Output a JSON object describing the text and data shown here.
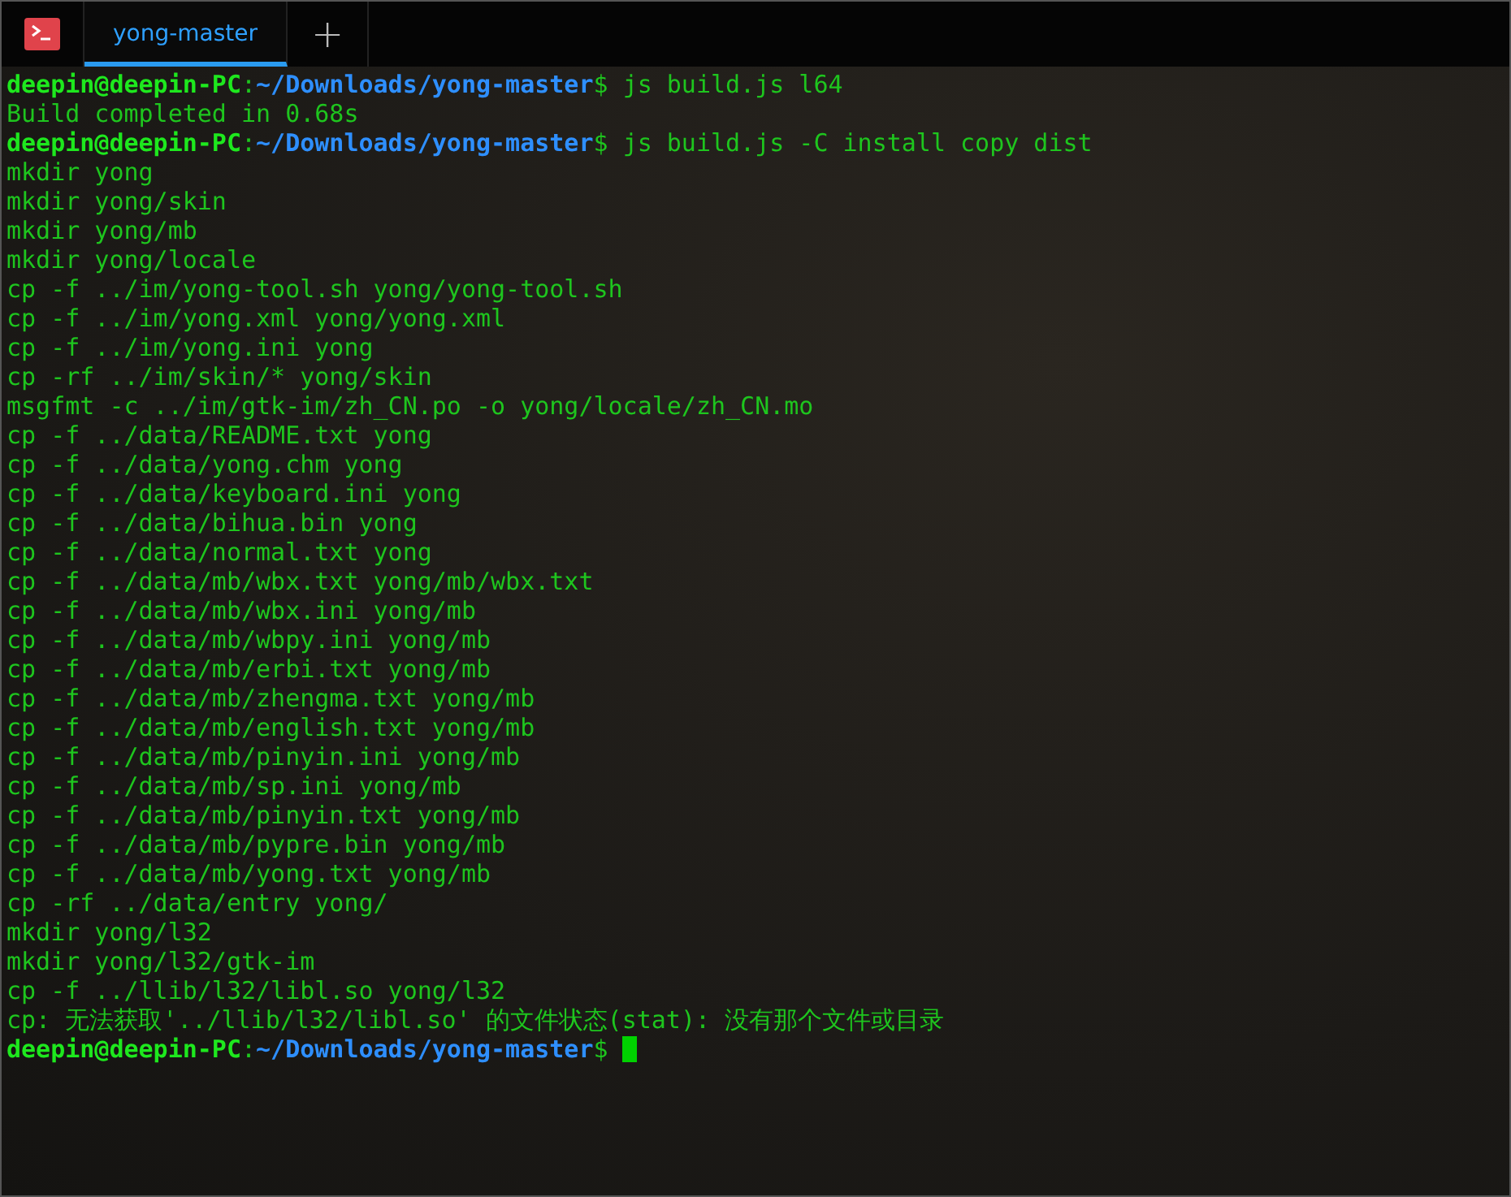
{
  "tabs": [
    {
      "label": "yong-master",
      "selected": true
    }
  ],
  "new_tab": "+",
  "lines": [
    {
      "kind": "prompt",
      "user": "deepin@deepin-PC",
      "separator": ":",
      "path": "~/Downloads/yong-master",
      "sign": "$",
      "command": "js build.js l64"
    },
    {
      "kind": "output",
      "text": "Build completed in 0.68s"
    },
    {
      "kind": "prompt",
      "user": "deepin@deepin-PC",
      "separator": ":",
      "path": "~/Downloads/yong-master",
      "sign": "$",
      "command": "js build.js -C install copy dist"
    },
    {
      "kind": "output",
      "text": "mkdir yong"
    },
    {
      "kind": "output",
      "text": "mkdir yong/skin"
    },
    {
      "kind": "output",
      "text": "mkdir yong/mb"
    },
    {
      "kind": "output",
      "text": "mkdir yong/locale"
    },
    {
      "kind": "output",
      "text": "cp -f ../im/yong-tool.sh yong/yong-tool.sh"
    },
    {
      "kind": "output",
      "text": "cp -f ../im/yong.xml yong/yong.xml"
    },
    {
      "kind": "output",
      "text": "cp -f ../im/yong.ini yong"
    },
    {
      "kind": "output",
      "text": "cp -rf ../im/skin/* yong/skin"
    },
    {
      "kind": "output",
      "text": "msgfmt -c ../im/gtk-im/zh_CN.po -o yong/locale/zh_CN.mo"
    },
    {
      "kind": "output",
      "text": "cp -f ../data/README.txt yong"
    },
    {
      "kind": "output",
      "text": "cp -f ../data/yong.chm yong"
    },
    {
      "kind": "output",
      "text": "cp -f ../data/keyboard.ini yong"
    },
    {
      "kind": "output",
      "text": "cp -f ../data/bihua.bin yong"
    },
    {
      "kind": "output",
      "text": "cp -f ../data/normal.txt yong"
    },
    {
      "kind": "output",
      "text": "cp -f ../data/mb/wbx.txt yong/mb/wbx.txt"
    },
    {
      "kind": "output",
      "text": "cp -f ../data/mb/wbx.ini yong/mb"
    },
    {
      "kind": "output",
      "text": "cp -f ../data/mb/wbpy.ini yong/mb"
    },
    {
      "kind": "output",
      "text": "cp -f ../data/mb/erbi.txt yong/mb"
    },
    {
      "kind": "output",
      "text": "cp -f ../data/mb/zhengma.txt yong/mb"
    },
    {
      "kind": "output",
      "text": "cp -f ../data/mb/english.txt yong/mb"
    },
    {
      "kind": "output",
      "text": "cp -f ../data/mb/pinyin.ini yong/mb"
    },
    {
      "kind": "output",
      "text": "cp -f ../data/mb/sp.ini yong/mb"
    },
    {
      "kind": "output",
      "text": "cp -f ../data/mb/pinyin.txt yong/mb"
    },
    {
      "kind": "output",
      "text": "cp -f ../data/mb/pypre.bin yong/mb"
    },
    {
      "kind": "output",
      "text": "cp -f ../data/mb/yong.txt yong/mb"
    },
    {
      "kind": "output",
      "text": "cp -rf ../data/entry yong/"
    },
    {
      "kind": "output",
      "text": "mkdir yong/l32"
    },
    {
      "kind": "output",
      "text": "mkdir yong/l32/gtk-im"
    },
    {
      "kind": "output",
      "text": "cp -f ../llib/l32/libl.so yong/l32"
    },
    {
      "kind": "output",
      "text": "cp: 无法获取'../llib/l32/libl.so' 的文件状态(stat): 没有那个文件或目录"
    },
    {
      "kind": "prompt",
      "user": "deepin@deepin-PC",
      "separator": ":",
      "path": "~/Downloads/yong-master",
      "sign": "$",
      "cursor": true
    }
  ]
}
